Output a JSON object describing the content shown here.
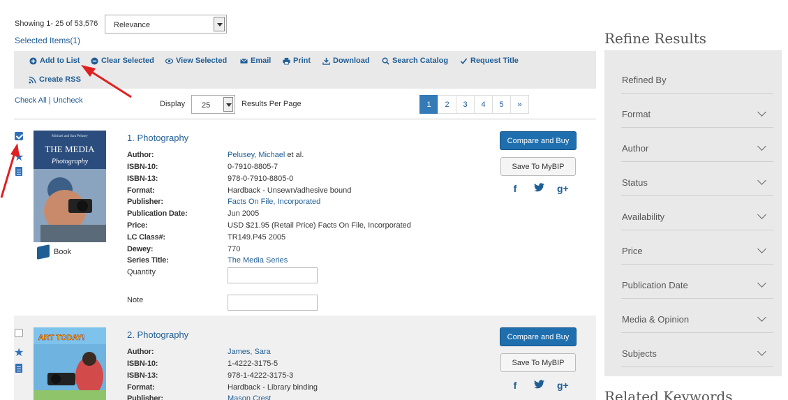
{
  "header": {
    "showing": "Showing 1- 25 of 53,576",
    "sort_value": "Relevance",
    "selected_items": "Selected Items(1)"
  },
  "actions": [
    {
      "label": "Add to List",
      "icon": "plus-circle-icon"
    },
    {
      "label": "Clear Selected",
      "icon": "minus-circle-icon"
    },
    {
      "label": "View Selected",
      "icon": "eye-icon"
    },
    {
      "label": "Email",
      "icon": "envelope-icon"
    },
    {
      "label": "Print",
      "icon": "printer-icon"
    },
    {
      "label": "Download",
      "icon": "download-icon"
    },
    {
      "label": "Search Catalog",
      "icon": "search-icon"
    },
    {
      "label": "Request Title",
      "icon": "checkmark-icon"
    },
    {
      "label": "Create RSS",
      "icon": "rss-icon"
    }
  ],
  "list_controls": {
    "check_all": "Check All | Uncheck",
    "display_label": "Display",
    "per_page": "25",
    "results_per_page": "Results Per Page"
  },
  "pager": [
    "1",
    "2",
    "3",
    "4",
    "5",
    "»"
  ],
  "pager_active": "1",
  "results": [
    {
      "checked": true,
      "title": "1. Photography",
      "format_label": "Book",
      "cover_text": "THE MEDIA",
      "cover_subtext": "Photography",
      "cover_authors": "Michael and Sara Pelusey",
      "fields": [
        {
          "key": "Author:",
          "value": "Pelusey, Michael",
          "suffix": " et al.",
          "link": true
        },
        {
          "key": "ISBN-10:",
          "value": "0-7910-8805-7",
          "link": false
        },
        {
          "key": "ISBN-13:",
          "value": "978-0-7910-8805-0",
          "link": false
        },
        {
          "key": "Format:",
          "value": "Hardback - Unsewn/adhesive bound",
          "link": false
        },
        {
          "key": "Publisher:",
          "value": "Facts On File, Incorporated",
          "link": true
        },
        {
          "key": "Publication Date:",
          "value": "Jun 2005",
          "link": false
        },
        {
          "key": "Price:",
          "value": "USD $21.95 (Retail Price) Facts On File, Incorporated",
          "link": false
        },
        {
          "key": "LC Class#:",
          "value": "TR149.P45 2005",
          "link": false
        },
        {
          "key": "Dewey:",
          "value": "770",
          "link": false
        },
        {
          "key": "Series Title:",
          "value": "The Media Series",
          "link": true
        }
      ],
      "quantity_label": "Quantity",
      "note_label": "Note",
      "buy_label": "Compare and Buy",
      "save_label": "Save To MyBIP"
    },
    {
      "checked": false,
      "title": "2. Photography",
      "cover_text": "ART TODAY!",
      "fields": [
        {
          "key": "Author:",
          "value": "James, Sara",
          "link": true
        },
        {
          "key": "ISBN-10:",
          "value": "1-4222-3175-5",
          "link": false
        },
        {
          "key": "ISBN-13:",
          "value": "978-1-4222-3175-3",
          "link": false
        },
        {
          "key": "Format:",
          "value": "Hardback - Library binding",
          "link": false
        },
        {
          "key": "Publisher:",
          "value": "Mason Crest",
          "link": true
        }
      ],
      "buy_label": "Compare and Buy",
      "save_label": "Save To MyBIP"
    }
  ],
  "social": [
    "f",
    "t",
    "g+"
  ],
  "sidebar": {
    "title": "Refine Results",
    "refined_by": "Refined By",
    "facets": [
      "Format",
      "Author",
      "Status",
      "Availability",
      "Price",
      "Publication Date",
      "Media & Opinion",
      "Subjects"
    ],
    "related_title": "Related Keywords"
  },
  "colors": {
    "link": "#1f5d95",
    "primary_button": "#1f6fae",
    "action_bar_bg": "#e9e9e9",
    "annotation_arrow": "#e02020"
  }
}
